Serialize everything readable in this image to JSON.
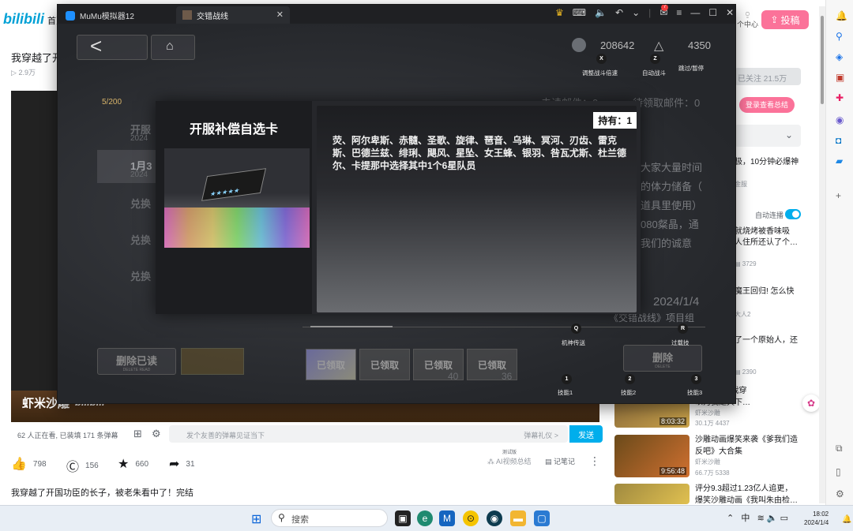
{
  "bili": {
    "logo": "bilibili",
    "nav_home": "首页",
    "user_center": "个中心",
    "upload": "投稿",
    "video_title": "我穿越了开",
    "views": "2.9万",
    "online_status": "62 人正在看, 已装填 171 条弹幕",
    "danmaku_placeholder": "发个友善的弹幕见证当下",
    "danmaku_etiquette": "弹幕礼仪 >",
    "send": "发送",
    "likes": "798",
    "coins": "156",
    "favorites": "660",
    "shares": "31",
    "ai_summary": "AI视频总结",
    "ai_test": "测试版",
    "notes": "记笔记",
    "desc_title": "我穿越了开国功臣的长子，被老朱看中了！完结",
    "watermark_name": "虾米沙雕",
    "watermark_logo": "bilibili"
  },
  "right_col": {
    "followed": "已关注 21.5万",
    "login_btn": "登录查看总结",
    "snippet1": "极，10分钟必爆神",
    "snippet1_meta": "金服",
    "auto_play": "自动连播",
    "snippet2a": "就烧烤被香味吸",
    "snippet2b": "人住所还认了个…",
    "snippet2_meta": "3729",
    "snippet3a": "魔王回归! 怎么快",
    "snippet3_meta": "大人2",
    "snippet4a": "了一个原始人，还",
    "snippet4_meta": "2390",
    "cards": [
      {
        "title": "是仙人》: 我穿\n以为我是天下…",
        "uploader": "虾米沙雕",
        "stats": "30.1万  4437",
        "duration": "8:03:32"
      },
      {
        "title": "沙雕动画爆笑来袭《爹我们造\n反吧》大合集",
        "uploader": "虾米沙雕",
        "stats": "66.7万  5338",
        "duration": "9:56:48"
      },
      {
        "title": "评分9.3超过1.23亿人追更，\n爆笑沙雕动画《我叫朱由检…",
        "uploader": "",
        "stats": "",
        "duration": ""
      }
    ]
  },
  "mumu": {
    "app_tab": "MuMu模拟器12",
    "game_tab": "交错战线",
    "mail_badge": "7",
    "game": {
      "res1": "208642",
      "res2": "4350",
      "mail_count": "5/200",
      "unread_mail": "未读邮件：0",
      "pending_mail": "待领取邮件：0",
      "list_items": [
        "开服",
        "1月3",
        "兑换",
        "兑换",
        "兑换"
      ],
      "list_dates": [
        "2024",
        "2024"
      ],
      "bg_text": [
        "大家大量时间",
        "的体力储备（",
        "道具里使用）",
        "080粲晶，通",
        "我们的诚意"
      ],
      "date": "2024/1/4",
      "org": "《交错战线》项目组",
      "delete_read": "删除已读",
      "delete_read_sub": "DELETE READ",
      "delete": "删除",
      "delete_sub": "DELETE",
      "claimed": [
        "已领取",
        "已领取",
        "已领取",
        "已领取"
      ],
      "counts": [
        "40",
        "36"
      ],
      "keys": {
        "x_key": "X",
        "x_label": "调整战斗倍速",
        "z_key": "Z",
        "z_label": "自动战斗",
        "pause_label": "跳过/暂停",
        "q_key": "Q",
        "q_label": "机神传送",
        "r_key": "R",
        "r_label": "过载技",
        "k1_key": "1",
        "k1_label": "技能1",
        "k2_key": "2",
        "k2_label": "技能2",
        "k3_key": "3",
        "k3_label": "技能3"
      },
      "modal": {
        "title": "开服补偿自选卡",
        "holding": "持有：1",
        "description": "荧、阿尔卑斯、赤髓、圣歌、旋律、琶音、乌琳、冥河、刃齿、雷克斯、巴德兰兹、绯琍、飓风、星坠、女王蜂、银羽、咎瓦尤斯、杜兰德尔、卡提那中选择其中1个6星队员"
      }
    }
  },
  "taskbar": {
    "search": "搜索",
    "ime": "中",
    "time": "18:02",
    "date": "2024/1/4"
  }
}
